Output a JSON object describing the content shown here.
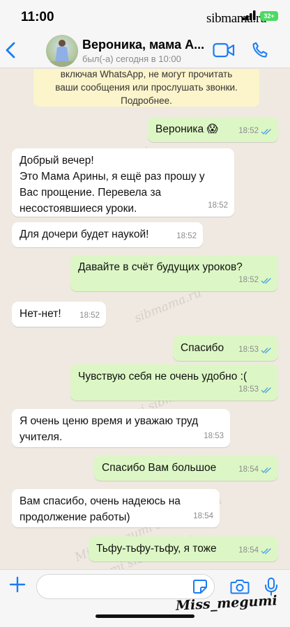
{
  "status_bar": {
    "time": "11:00",
    "watermark": "sibmama.ru",
    "battery": "32+"
  },
  "header": {
    "back_icon": "chevron-left",
    "contact_name": "Вероника, мама А...",
    "last_seen": "был(-а) сегодня в 10:00",
    "video_icon": "video-camera",
    "call_icon": "phone"
  },
  "notice": {
    "text": "включая WhatsApp, не могут прочитать\nваши сообщения или прослушать звонки.\nПодробнее."
  },
  "messages": [
    {
      "direction": "out",
      "text": "Вероника 😱",
      "time": "18:52",
      "read": true
    },
    {
      "direction": "in",
      "text": "Добрый вечер!\nЭто Мама Арины, я ещё раз прошу у\nВас прощение. Перевела за\nнесостоявшиеся уроки.",
      "time": "18:52"
    },
    {
      "direction": "in",
      "text": "Для дочери будет наукой!",
      "time": "18:52"
    },
    {
      "direction": "out",
      "text": "Давайте в счёт будущих уроков?",
      "time": "18:52",
      "read": true
    },
    {
      "direction": "in",
      "text": "Нет-нет!",
      "time": "18:52"
    },
    {
      "direction": "out",
      "text": "Спасибо",
      "time": "18:53",
      "read": true
    },
    {
      "direction": "out",
      "text": "Чувствую себя не очень удобно :(",
      "time": "18:53",
      "read": true
    },
    {
      "direction": "in",
      "text": "Я очень ценю время и уважаю труд\nучителя.",
      "time": "18:53"
    },
    {
      "direction": "out",
      "text": "Спасибо Вам большое",
      "time": "18:54",
      "read": true
    },
    {
      "direction": "in",
      "text": "Вам спасибо, очень надеюсь на\nпродолжение работы)",
      "time": "18:54"
    },
    {
      "direction": "out",
      "text": "Тьфу-тьфу-тьфу, я тоже",
      "time": "18:54",
      "read": true
    }
  ],
  "watermarks": [
    "Miss_megumi",
    "sibmama.ru",
    "Miss_megumi sibmama.ru",
    "Miss_megumi sibmama.ru",
    "Miss_megumi sibmama.ru"
  ],
  "input_bar": {
    "placeholder": "",
    "plus_icon": "plus",
    "sticker_icon": "sticker",
    "camera_icon": "camera",
    "mic_icon": "microphone"
  },
  "signature": "Miss_megumi",
  "colors": {
    "accent": "#1a7cf5",
    "incoming_bubble": "#ffffff",
    "outgoing_bubble": "#dcf7c5",
    "read_ticks": "#4fa6e8",
    "notice_bg": "#fcf4cb"
  }
}
